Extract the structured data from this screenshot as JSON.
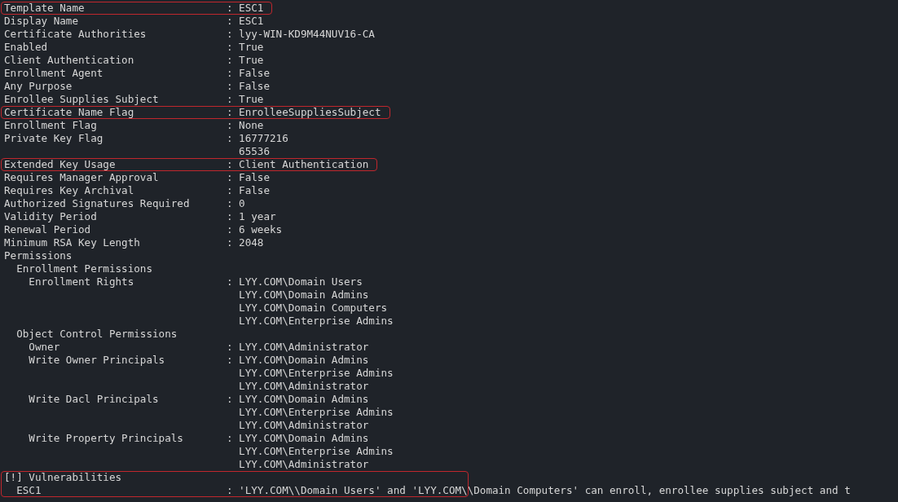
{
  "separator": ":",
  "lines": [
    {
      "key": "Template Name",
      "values": [
        "ESC1"
      ],
      "highlighted": true
    },
    {
      "key": "Display Name",
      "values": [
        "ESC1"
      ],
      "highlighted": false
    },
    {
      "key": "Certificate Authorities",
      "values": [
        "lyy-WIN-KD9M44NUV16-CA"
      ],
      "highlighted": false
    },
    {
      "key": "Enabled",
      "values": [
        "True"
      ],
      "highlighted": false
    },
    {
      "key": "Client Authentication",
      "values": [
        "True"
      ],
      "highlighted": false
    },
    {
      "key": "Enrollment Agent",
      "values": [
        "False"
      ],
      "highlighted": false
    },
    {
      "key": "Any Purpose",
      "values": [
        "False"
      ],
      "highlighted": false
    },
    {
      "key": "Enrollee Supplies Subject",
      "values": [
        "True"
      ],
      "highlighted": false
    },
    {
      "key": "Certificate Name Flag",
      "values": [
        "EnrolleeSuppliesSubject"
      ],
      "highlighted": true
    },
    {
      "key": "Enrollment Flag",
      "values": [
        "None"
      ],
      "highlighted": false
    },
    {
      "key": "Private Key Flag",
      "values": [
        "16777216",
        "65536"
      ],
      "highlighted": false
    },
    {
      "key": "Extended Key Usage",
      "values": [
        "Client Authentication"
      ],
      "highlighted": true
    },
    {
      "key": "Requires Manager Approval",
      "values": [
        "False"
      ],
      "highlighted": false
    },
    {
      "key": "Requires Key Archival",
      "values": [
        "False"
      ],
      "highlighted": false
    },
    {
      "key": "Authorized Signatures Required",
      "values": [
        "0"
      ],
      "highlighted": false
    },
    {
      "key": "Validity Period",
      "values": [
        "1 year"
      ],
      "highlighted": false
    },
    {
      "key": "Renewal Period",
      "values": [
        "6 weeks"
      ],
      "highlighted": false
    },
    {
      "key": "Minimum RSA Key Length",
      "values": [
        "2048"
      ],
      "highlighted": false
    },
    {
      "key": "Permissions",
      "highlighted": false,
      "children": [
        {
          "key": "Enrollment Permissions",
          "highlighted": false,
          "children": [
            {
              "key": "Enrollment Rights",
              "values": [
                "LYY.COM\\Domain Users",
                "LYY.COM\\Domain Admins",
                "LYY.COM\\Domain Computers",
                "LYY.COM\\Enterprise Admins"
              ],
              "highlighted": false
            }
          ]
        },
        {
          "key": "Object Control Permissions",
          "highlighted": false,
          "children": [
            {
              "key": "Owner",
              "values": [
                "LYY.COM\\Administrator"
              ],
              "highlighted": false
            },
            {
              "key": "Write Owner Principals",
              "values": [
                "LYY.COM\\Domain Admins",
                "LYY.COM\\Enterprise Admins",
                "LYY.COM\\Administrator"
              ],
              "highlighted": false
            },
            {
              "key": "Write Dacl Principals",
              "values": [
                "LYY.COM\\Domain Admins",
                "LYY.COM\\Enterprise Admins",
                "LYY.COM\\Administrator"
              ],
              "highlighted": false
            },
            {
              "key": "Write Property Principals",
              "values": [
                "LYY.COM\\Domain Admins",
                "LYY.COM\\Enterprise Admins",
                "LYY.COM\\Administrator"
              ],
              "highlighted": false
            }
          ]
        }
      ]
    }
  ],
  "vulnerabilities": {
    "heading": "[!] Vulnerabilities",
    "highlighted": true,
    "items": [
      {
        "key": "ESC1",
        "values": [
          "'LYY.COM\\\\Domain Users' and 'LYY.COM\\\\Domain Computers' can enroll, enrollee supplies subject and t"
        ]
      }
    ]
  }
}
